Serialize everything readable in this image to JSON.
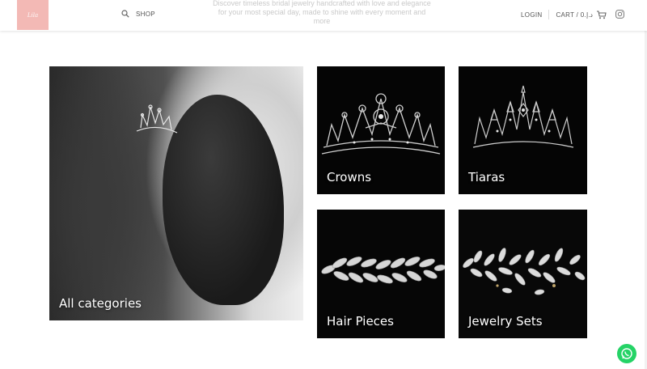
{
  "header": {
    "logo_text": "Lila",
    "shop_label": "SHOP",
    "login_label": "LOGIN",
    "cart_label": "CART / 0.ﺩ.ﺇ",
    "faded_lines": [
      "Discover timeless bridal jewelry handcrafted with love and elegance",
      "for your most special day, made to shine with every moment and",
      "more"
    ]
  },
  "categories": [
    {
      "label": "All categories"
    },
    {
      "label": "Crowns"
    },
    {
      "label": "Tiaras"
    },
    {
      "label": "Hair Pieces"
    },
    {
      "label": "Jewelry Sets"
    }
  ],
  "colors": {
    "logo_bg": "#f3b9b5",
    "whatsapp": "#25d366"
  },
  "icons": [
    "search-icon",
    "cart-icon",
    "instagram-icon",
    "whatsapp-icon"
  ]
}
